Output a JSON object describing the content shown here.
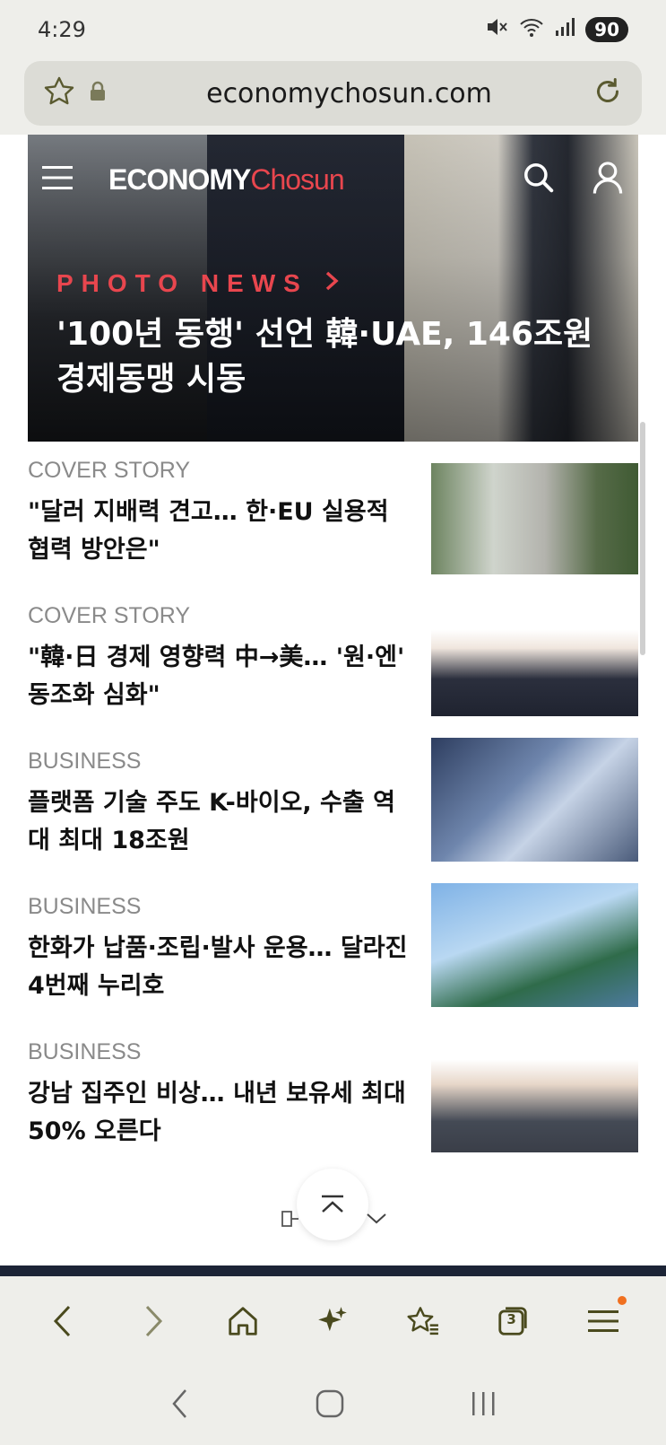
{
  "status": {
    "time": "4:29",
    "battery": "90"
  },
  "browser": {
    "url": "economychosun.com"
  },
  "site": {
    "logo_main": "ECONOMY",
    "logo_accent": "Chosun"
  },
  "hero": {
    "kicker": "PHOTO NEWS",
    "headline": "'100년 동행' 선언 韓·UAE, 146조원 경제동맹 시동"
  },
  "articles": [
    {
      "category": "COVER STORY",
      "title": "\"달러 지배력 견고… 한·EU 실용적 협력 방안은\""
    },
    {
      "category": "COVER STORY",
      "title": "\"韓·日 경제 영향력 中→美… '원·엔' 동조화 심화\""
    },
    {
      "category": "BUSINESS",
      "title": "플랫폼 기술 주도 K-바이오, 수출 역대 최대 18조원"
    },
    {
      "category": "BUSINESS",
      "title": "한화가 납품·조립·발사 운용… 달라진 4번째 누리호"
    },
    {
      "category": "BUSINESS",
      "title": "강남 집주인 비상… 내년 보유세 최대 50% 오른다"
    }
  ],
  "tabs_count": "3",
  "colors": {
    "accent": "#e8464e",
    "icon": "#4a4a1e",
    "notify": "#f07020"
  }
}
